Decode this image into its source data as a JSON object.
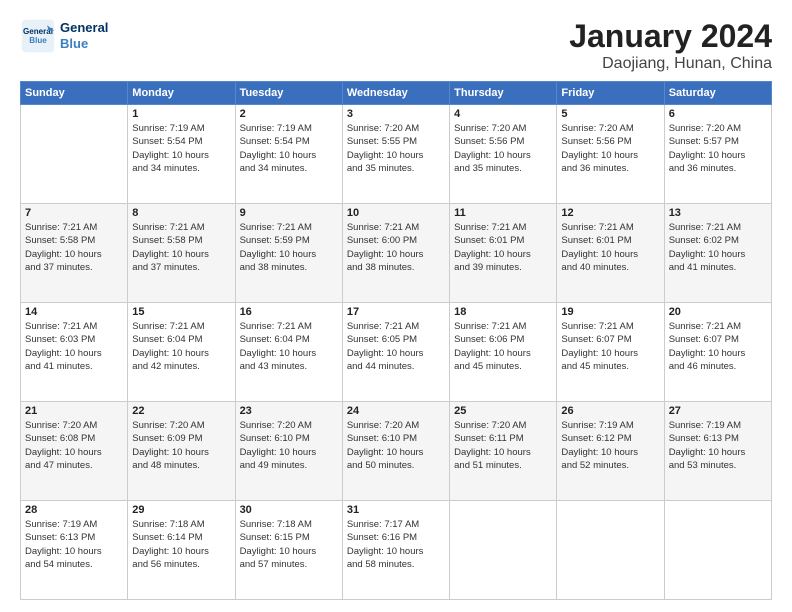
{
  "header": {
    "logo_line1": "General",
    "logo_line2": "Blue",
    "title": "January 2024",
    "subtitle": "Daojiang, Hunan, China"
  },
  "days_of_week": [
    "Sunday",
    "Monday",
    "Tuesday",
    "Wednesday",
    "Thursday",
    "Friday",
    "Saturday"
  ],
  "weeks": [
    [
      {
        "day": "",
        "info": ""
      },
      {
        "day": "1",
        "info": "Sunrise: 7:19 AM\nSunset: 5:54 PM\nDaylight: 10 hours\nand 34 minutes."
      },
      {
        "day": "2",
        "info": "Sunrise: 7:19 AM\nSunset: 5:54 PM\nDaylight: 10 hours\nand 34 minutes."
      },
      {
        "day": "3",
        "info": "Sunrise: 7:20 AM\nSunset: 5:55 PM\nDaylight: 10 hours\nand 35 minutes."
      },
      {
        "day": "4",
        "info": "Sunrise: 7:20 AM\nSunset: 5:56 PM\nDaylight: 10 hours\nand 35 minutes."
      },
      {
        "day": "5",
        "info": "Sunrise: 7:20 AM\nSunset: 5:56 PM\nDaylight: 10 hours\nand 36 minutes."
      },
      {
        "day": "6",
        "info": "Sunrise: 7:20 AM\nSunset: 5:57 PM\nDaylight: 10 hours\nand 36 minutes."
      }
    ],
    [
      {
        "day": "7",
        "info": "Sunrise: 7:21 AM\nSunset: 5:58 PM\nDaylight: 10 hours\nand 37 minutes."
      },
      {
        "day": "8",
        "info": "Sunrise: 7:21 AM\nSunset: 5:58 PM\nDaylight: 10 hours\nand 37 minutes."
      },
      {
        "day": "9",
        "info": "Sunrise: 7:21 AM\nSunset: 5:59 PM\nDaylight: 10 hours\nand 38 minutes."
      },
      {
        "day": "10",
        "info": "Sunrise: 7:21 AM\nSunset: 6:00 PM\nDaylight: 10 hours\nand 38 minutes."
      },
      {
        "day": "11",
        "info": "Sunrise: 7:21 AM\nSunset: 6:01 PM\nDaylight: 10 hours\nand 39 minutes."
      },
      {
        "day": "12",
        "info": "Sunrise: 7:21 AM\nSunset: 6:01 PM\nDaylight: 10 hours\nand 40 minutes."
      },
      {
        "day": "13",
        "info": "Sunrise: 7:21 AM\nSunset: 6:02 PM\nDaylight: 10 hours\nand 41 minutes."
      }
    ],
    [
      {
        "day": "14",
        "info": "Sunrise: 7:21 AM\nSunset: 6:03 PM\nDaylight: 10 hours\nand 41 minutes."
      },
      {
        "day": "15",
        "info": "Sunrise: 7:21 AM\nSunset: 6:04 PM\nDaylight: 10 hours\nand 42 minutes."
      },
      {
        "day": "16",
        "info": "Sunrise: 7:21 AM\nSunset: 6:04 PM\nDaylight: 10 hours\nand 43 minutes."
      },
      {
        "day": "17",
        "info": "Sunrise: 7:21 AM\nSunset: 6:05 PM\nDaylight: 10 hours\nand 44 minutes."
      },
      {
        "day": "18",
        "info": "Sunrise: 7:21 AM\nSunset: 6:06 PM\nDaylight: 10 hours\nand 45 minutes."
      },
      {
        "day": "19",
        "info": "Sunrise: 7:21 AM\nSunset: 6:07 PM\nDaylight: 10 hours\nand 45 minutes."
      },
      {
        "day": "20",
        "info": "Sunrise: 7:21 AM\nSunset: 6:07 PM\nDaylight: 10 hours\nand 46 minutes."
      }
    ],
    [
      {
        "day": "21",
        "info": "Sunrise: 7:20 AM\nSunset: 6:08 PM\nDaylight: 10 hours\nand 47 minutes."
      },
      {
        "day": "22",
        "info": "Sunrise: 7:20 AM\nSunset: 6:09 PM\nDaylight: 10 hours\nand 48 minutes."
      },
      {
        "day": "23",
        "info": "Sunrise: 7:20 AM\nSunset: 6:10 PM\nDaylight: 10 hours\nand 49 minutes."
      },
      {
        "day": "24",
        "info": "Sunrise: 7:20 AM\nSunset: 6:10 PM\nDaylight: 10 hours\nand 50 minutes."
      },
      {
        "day": "25",
        "info": "Sunrise: 7:20 AM\nSunset: 6:11 PM\nDaylight: 10 hours\nand 51 minutes."
      },
      {
        "day": "26",
        "info": "Sunrise: 7:19 AM\nSunset: 6:12 PM\nDaylight: 10 hours\nand 52 minutes."
      },
      {
        "day": "27",
        "info": "Sunrise: 7:19 AM\nSunset: 6:13 PM\nDaylight: 10 hours\nand 53 minutes."
      }
    ],
    [
      {
        "day": "28",
        "info": "Sunrise: 7:19 AM\nSunset: 6:13 PM\nDaylight: 10 hours\nand 54 minutes."
      },
      {
        "day": "29",
        "info": "Sunrise: 7:18 AM\nSunset: 6:14 PM\nDaylight: 10 hours\nand 56 minutes."
      },
      {
        "day": "30",
        "info": "Sunrise: 7:18 AM\nSunset: 6:15 PM\nDaylight: 10 hours\nand 57 minutes."
      },
      {
        "day": "31",
        "info": "Sunrise: 7:17 AM\nSunset: 6:16 PM\nDaylight: 10 hours\nand 58 minutes."
      },
      {
        "day": "",
        "info": ""
      },
      {
        "day": "",
        "info": ""
      },
      {
        "day": "",
        "info": ""
      }
    ]
  ]
}
